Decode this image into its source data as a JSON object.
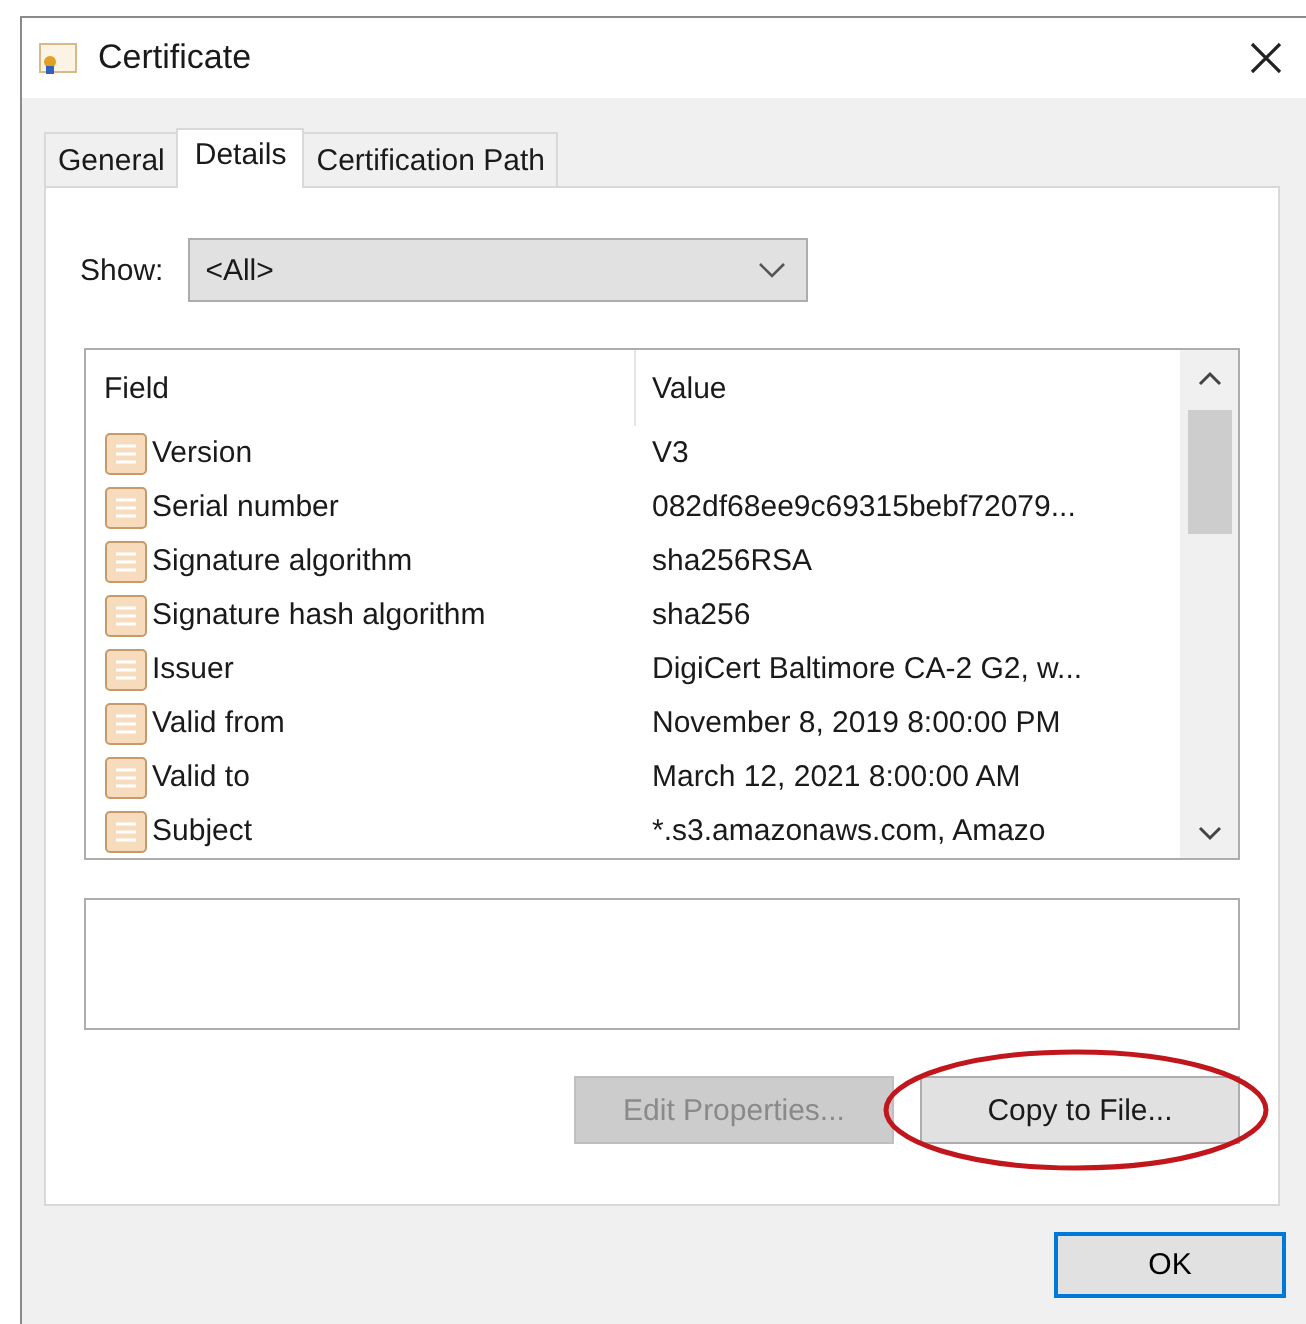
{
  "window": {
    "title": "Certificate"
  },
  "tabs": [
    {
      "label": "General",
      "selected": false
    },
    {
      "label": "Details",
      "selected": true
    },
    {
      "label": "Certification Path",
      "selected": false
    }
  ],
  "show": {
    "label": "Show:",
    "value": "<All>"
  },
  "table": {
    "columns": [
      "Field",
      "Value"
    ],
    "rows": [
      {
        "field": "Version",
        "value": "V3"
      },
      {
        "field": "Serial number",
        "value": "082df68ee9c69315bebf72079..."
      },
      {
        "field": "Signature algorithm",
        "value": "sha256RSA"
      },
      {
        "field": "Signature hash algorithm",
        "value": "sha256"
      },
      {
        "field": "Issuer",
        "value": "DigiCert Baltimore CA-2 G2, w..."
      },
      {
        "field": "Valid from",
        "value": "November 8, 2019 8:00:00 PM"
      },
      {
        "field": "Valid to",
        "value": "March 12, 2021 8:00:00 AM"
      },
      {
        "field": "Subject",
        "value": "*.s3.amazonaws.com, Amazo"
      }
    ]
  },
  "buttons": [
    {
      "label": "Edit Properties...",
      "disabled": true,
      "highlighted": false
    },
    {
      "label": "Copy to File...",
      "disabled": false,
      "highlighted": true
    }
  ],
  "ok_button": {
    "label": "OK"
  }
}
